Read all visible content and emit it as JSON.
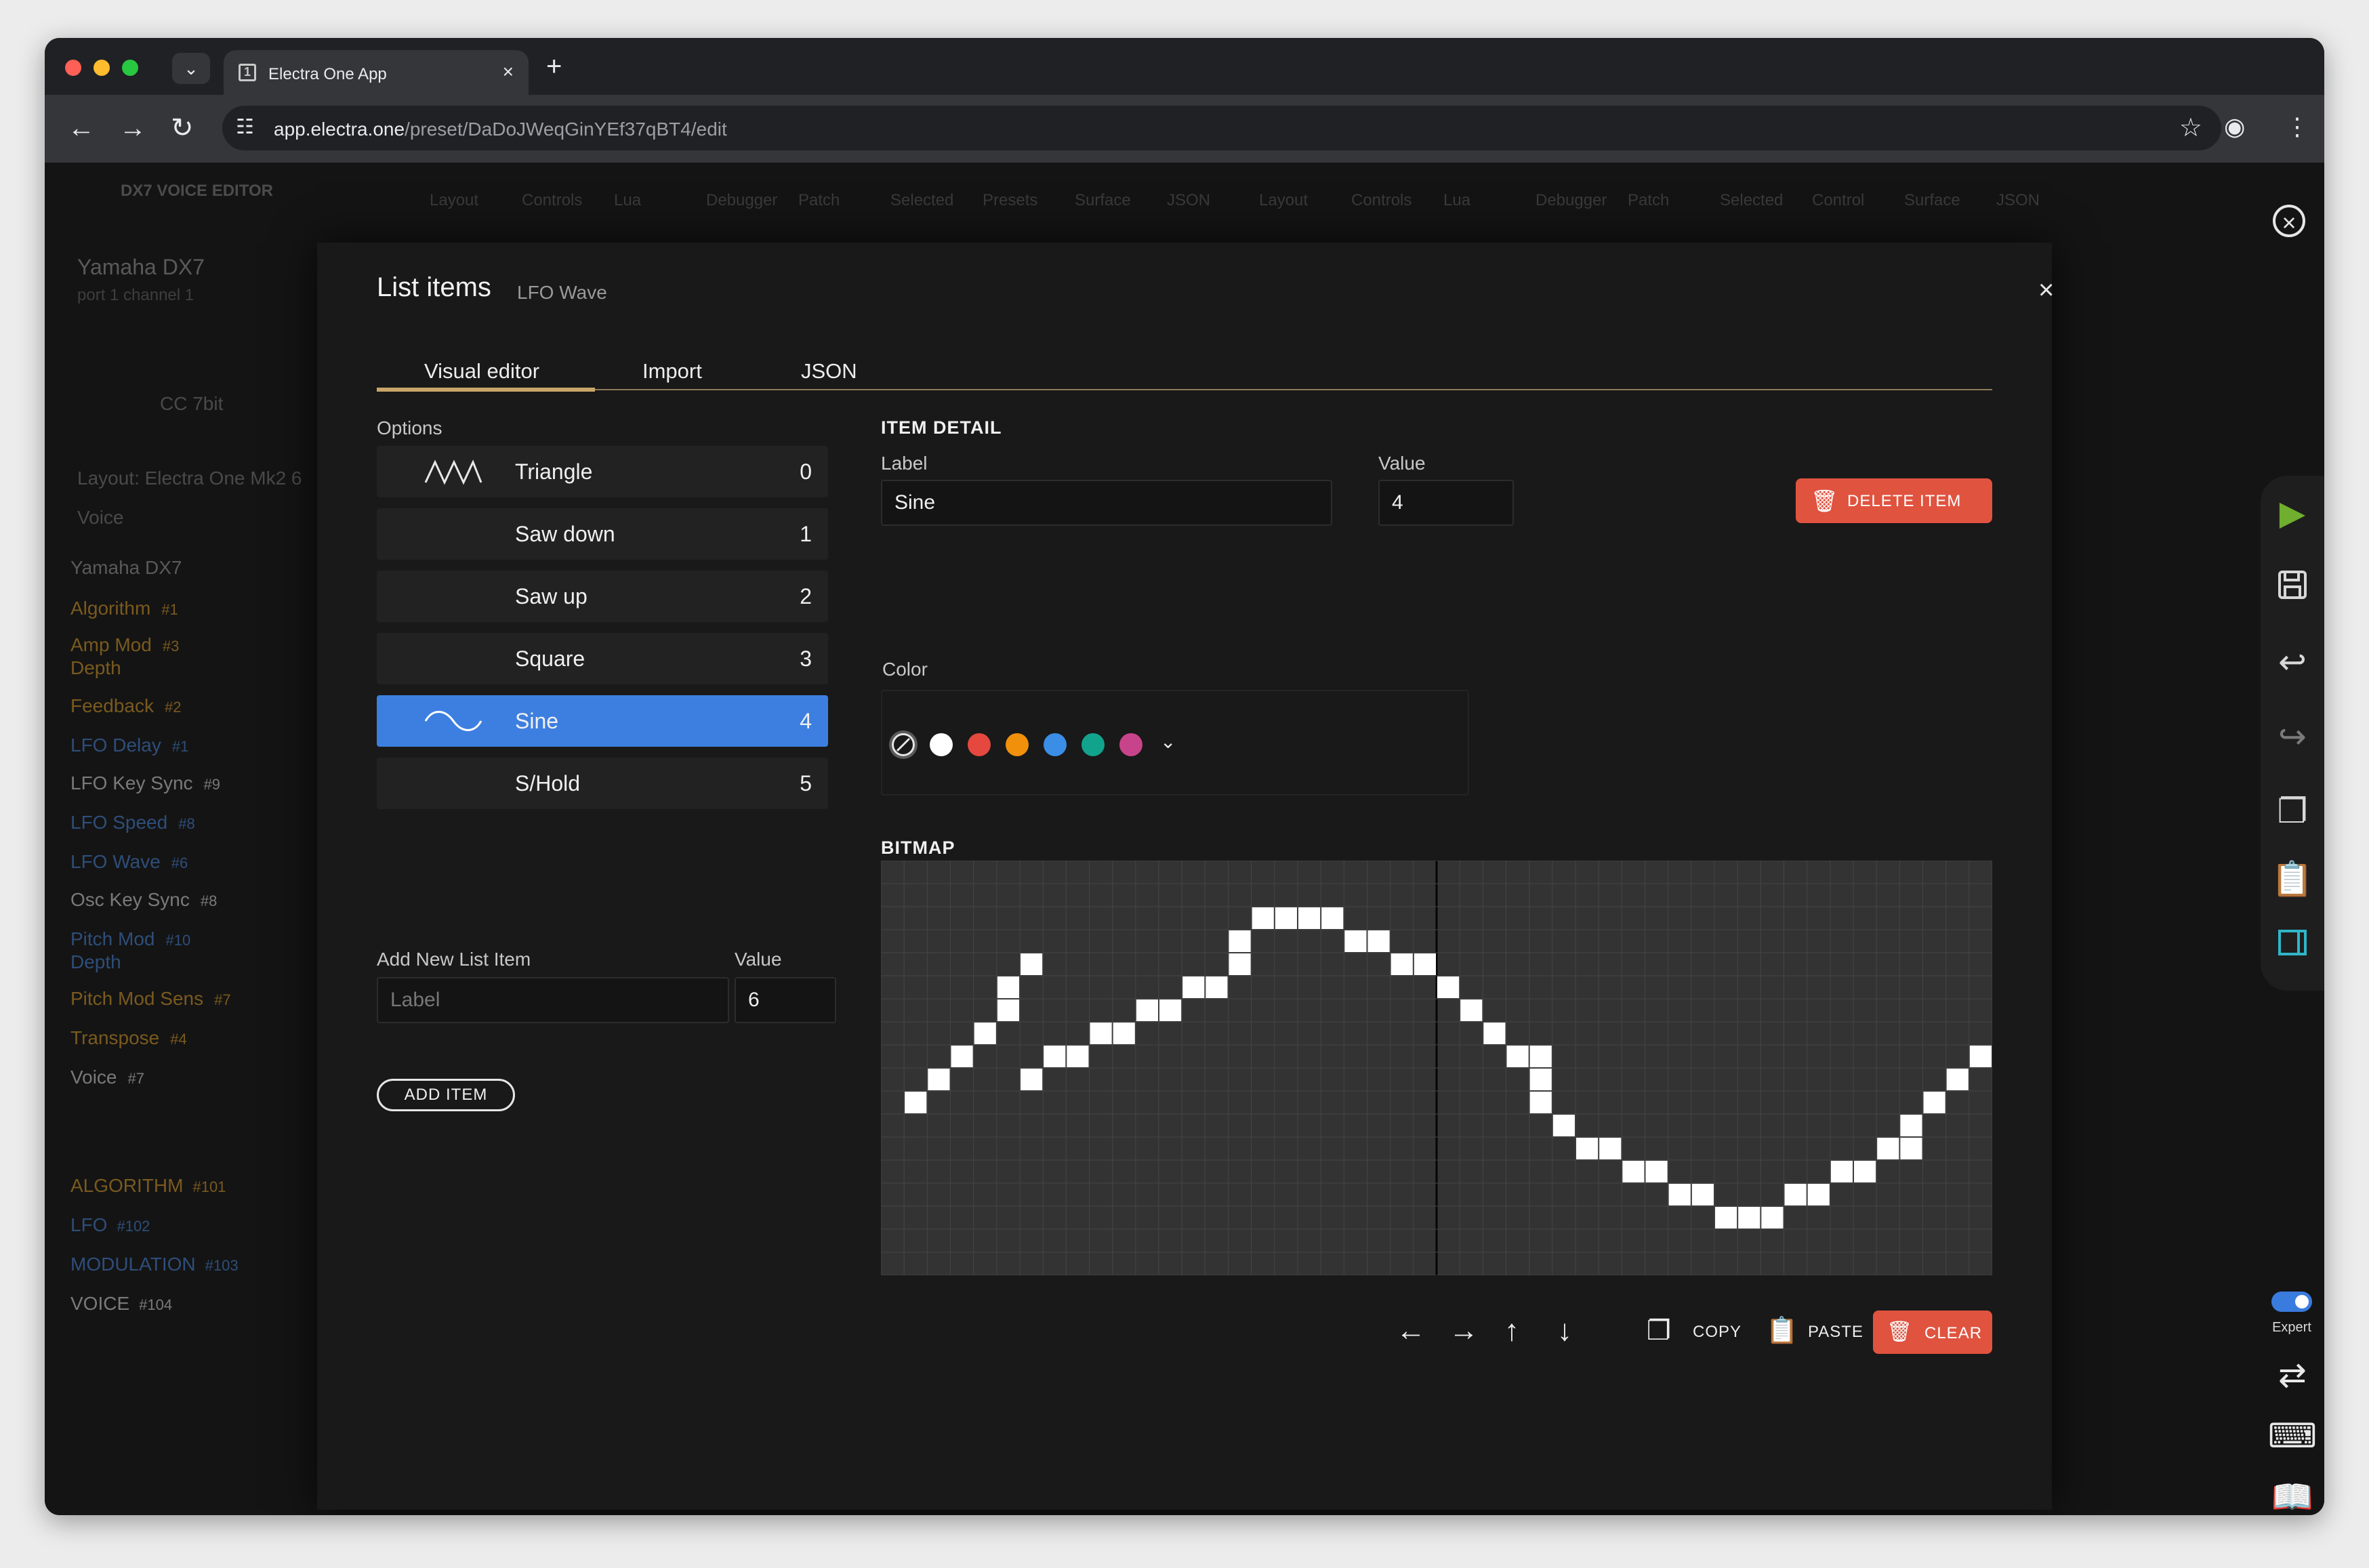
{
  "browser": {
    "tab_title": "Electra One App",
    "url_host": "app.electra.one",
    "url_path": "/preset/DaDoJWeqGinYEf37qBT4/edit"
  },
  "background": {
    "app_title": "DX7 VOICE EDITOR",
    "device_name": "Yamaha DX7",
    "device_port": "port 1 channel 1",
    "cc_label": "CC 7bit",
    "layout_label": "Layout: Electra One Mk2 6",
    "voice_label": "Voice",
    "group_header": "Yamaha DX7",
    "params": [
      {
        "name": "Algorithm",
        "num": "#1",
        "color": "#7a5a1e"
      },
      {
        "name": "Amp Mod",
        "num": "#3",
        "color": "#7a5a1e"
      },
      {
        "name": "Depth",
        "num": "",
        "color": "#7a5a1e"
      },
      {
        "name": "Feedback",
        "num": "#2",
        "color": "#7a5a1e"
      },
      {
        "name": "LFO Delay",
        "num": "#1",
        "color": "#2e4e7a"
      },
      {
        "name": "LFO Key Sync",
        "num": "#9",
        "color": "#7a7a7a"
      },
      {
        "name": "LFO Speed",
        "num": "#8",
        "color": "#2e4e7a"
      },
      {
        "name": "LFO Wave",
        "num": "#6",
        "color": "#2e4e7a"
      },
      {
        "name": "Osc Key Sync",
        "num": "#8",
        "color": "#7a7a7a"
      },
      {
        "name": "Pitch Mod",
        "num": "#10",
        "color": "#2e4e7a"
      },
      {
        "name": "Depth",
        "num": "",
        "color": "#2e4e7a"
      },
      {
        "name": "Pitch Mod Sens",
        "num": "#7",
        "color": "#7a5a1e"
      },
      {
        "name": "Transpose",
        "num": "#4",
        "color": "#7a5a1e"
      },
      {
        "name": "Voice",
        "num": "#7",
        "color": "#7a7a7a"
      }
    ],
    "pages": [
      {
        "name": "ALGORITHM",
        "num": "#101",
        "color": "#7a5a1e"
      },
      {
        "name": "LFO",
        "num": "#102",
        "color": "#2e4e7a"
      },
      {
        "name": "MODULATION",
        "num": "#103",
        "color": "#2e4e7a"
      },
      {
        "name": "VOICE",
        "num": "#104",
        "color": "#7a7a7a"
      }
    ],
    "top_tabs": [
      "Layout",
      "Controls",
      "Lua",
      "Debugger",
      "Patch",
      "Selected",
      "Presets",
      "Surface",
      "JSON",
      "Layout",
      "Controls",
      "Lua",
      "Debugger",
      "Patch",
      "Selected",
      "Control",
      "Surface",
      "JSON"
    ],
    "expert_label": "Expert"
  },
  "modal": {
    "title": "List items",
    "subtitle": "LFO Wave",
    "tabs": [
      {
        "label": "Visual editor",
        "active": true
      },
      {
        "label": "Import",
        "active": false
      },
      {
        "label": "JSON",
        "active": false
      }
    ],
    "options_label": "Options",
    "options": [
      {
        "label": "Triangle",
        "value": "0",
        "icon": "triangle-wave",
        "selected": false
      },
      {
        "label": "Saw down",
        "value": "1",
        "icon": "",
        "selected": false
      },
      {
        "label": "Saw up",
        "value": "2",
        "icon": "",
        "selected": false
      },
      {
        "label": "Square",
        "value": "3",
        "icon": "",
        "selected": false
      },
      {
        "label": "Sine",
        "value": "4",
        "icon": "sine-wave",
        "selected": true
      },
      {
        "label": "S/Hold",
        "value": "5",
        "icon": "",
        "selected": false
      }
    ],
    "add_new": {
      "label": "Add New List Item",
      "value_label": "Value",
      "label_placeholder": "Label",
      "value": "6",
      "button": "ADD ITEM"
    },
    "item_detail": {
      "heading": "ITEM DETAIL",
      "label_caption": "Label",
      "label_value": "Sine",
      "value_caption": "Value",
      "value": "4",
      "delete_button": "DELETE ITEM",
      "color_caption": "Color",
      "colors": [
        "none",
        "#ffffff",
        "#e5483f",
        "#f0900b",
        "#3b8ee6",
        "#12a38d",
        "#c8448a"
      ]
    },
    "bitmap": {
      "heading": "BITMAP",
      "columns": 48,
      "rows": 18,
      "pixels": [
        [
          9,
          6
        ],
        [
          8,
          7
        ],
        [
          8,
          8
        ],
        [
          7,
          9
        ],
        [
          7,
          10
        ],
        [
          6,
          11
        ],
        [
          6,
          12
        ],
        [
          5,
          13
        ],
        [
          5,
          14
        ],
        [
          4,
          15
        ],
        [
          3,
          15
        ],
        [
          2,
          16
        ],
        [
          2,
          17
        ],
        [
          2,
          18
        ],
        [
          2,
          19
        ],
        [
          3,
          20
        ],
        [
          3,
          21
        ],
        [
          4,
          22
        ],
        [
          4,
          23
        ],
        [
          5,
          24
        ],
        [
          6,
          25
        ],
        [
          7,
          26
        ],
        [
          8,
          27
        ],
        [
          8,
          28
        ],
        [
          9,
          28
        ],
        [
          10,
          28
        ],
        [
          11,
          29
        ],
        [
          12,
          30
        ],
        [
          12,
          31
        ],
        [
          13,
          32
        ],
        [
          13,
          33
        ],
        [
          14,
          34
        ],
        [
          14,
          35
        ],
        [
          15,
          36
        ],
        [
          15,
          37
        ],
        [
          15,
          38
        ],
        [
          14,
          39
        ],
        [
          14,
          40
        ],
        [
          13,
          41
        ],
        [
          13,
          42
        ],
        [
          12,
          43
        ],
        [
          12,
          44
        ],
        [
          11,
          44
        ],
        [
          10,
          45
        ],
        [
          9,
          46
        ],
        [
          8,
          47
        ],
        [
          10,
          1
        ],
        [
          9,
          2
        ],
        [
          8,
          3
        ],
        [
          7,
          4
        ],
        [
          6,
          5
        ],
        [
          5,
          5
        ],
        [
          4,
          6
        ]
      ],
      "copy_label": "COPY",
      "paste_label": "PASTE",
      "clear_label": "CLEAR"
    }
  }
}
